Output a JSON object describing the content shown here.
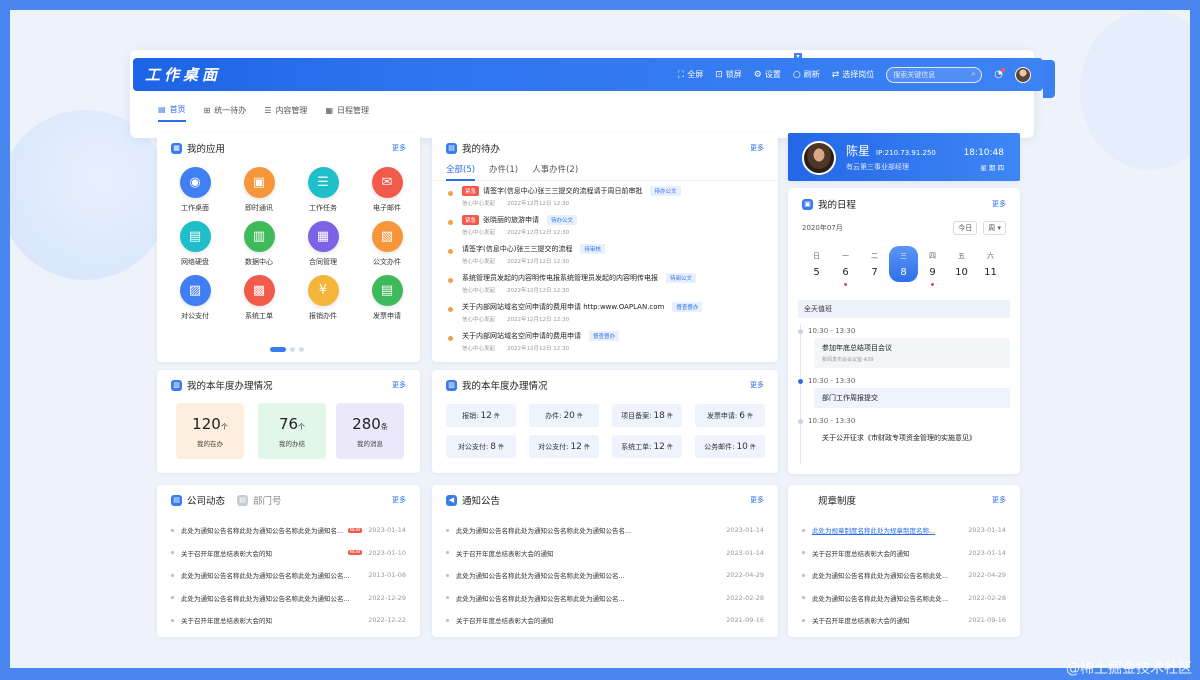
{
  "header": {
    "title": "工作桌面",
    "tools": [
      {
        "icon": "fullscreen-icon",
        "label": "全屏"
      },
      {
        "icon": "lock-icon",
        "label": "锁屏"
      },
      {
        "icon": "gear-icon",
        "label": "设置"
      },
      {
        "icon": "refresh-icon",
        "label": "刷新"
      },
      {
        "icon": "switch-role-icon",
        "label": "选择岗位"
      }
    ],
    "search_placeholder": "搜索关键信息"
  },
  "nav": [
    {
      "label": "首页",
      "active": true
    },
    {
      "label": "统一待办"
    },
    {
      "label": "内容管理"
    },
    {
      "label": "日程管理"
    }
  ],
  "apps": {
    "title": "我的应用",
    "more": "更多",
    "items": [
      {
        "label": "工作桌面",
        "color": "#3f7ef3",
        "glyph": "◉"
      },
      {
        "label": "即时通讯",
        "color": "#f6963a",
        "glyph": "▣"
      },
      {
        "label": "工作任务",
        "color": "#1fbfc9",
        "glyph": "☰"
      },
      {
        "label": "电子邮件",
        "color": "#f25b4b",
        "glyph": "✉"
      },
      {
        "label": "网络硬盘",
        "color": "#1fbfc9",
        "glyph": "▤"
      },
      {
        "label": "数据中心",
        "color": "#3fba5a",
        "glyph": "▥"
      },
      {
        "label": "合同管理",
        "color": "#7b62e6",
        "glyph": "▦"
      },
      {
        "label": "公文办件",
        "color": "#f6963a",
        "glyph": "▧"
      },
      {
        "label": "对公支付",
        "color": "#3f7ef3",
        "glyph": "▨"
      },
      {
        "label": "系统工单",
        "color": "#f25b4b",
        "glyph": "▩"
      },
      {
        "label": "报销办件",
        "color": "#f4b63a",
        "glyph": "¥"
      },
      {
        "label": "发票申请",
        "color": "#3fba5a",
        "glyph": "▤"
      }
    ]
  },
  "todo": {
    "title": "我的待办",
    "more": "更多",
    "tabs": [
      "全部(5)",
      "办件(1)",
      "人事办件(2)"
    ],
    "items": [
      {
        "urgent": "紧急",
        "text": "请签字(信息中心)张三三提交的流程请于周日前审批",
        "badge": "待办公文",
        "source": "信心中心发起",
        "time": "2022年12月12日 12:30"
      },
      {
        "urgent": "紧急",
        "text": "张晓丽的旅游申请",
        "badge": "待办公文",
        "source": "信心中心发起",
        "time": "2022年12月12日 12:30"
      },
      {
        "urgent": "",
        "text": "请签字(信息中心)张三三提交的流程",
        "badge": "待审核",
        "source": "信心中心发起",
        "time": "2022年12月12日 12:30"
      },
      {
        "urgent": "",
        "text": "系统管理员发起的内容明传电报系统管理员发起的内容明传电报",
        "badge": "待阅公文",
        "source": "信心中心发起",
        "time": "2022年12月12日 12:30"
      },
      {
        "urgent": "",
        "text": "关于内部网站域名空间申请的费用申请 http:www.OAPLAN.com",
        "badge": "督查督办",
        "source": "信心中心发起",
        "time": "2022年12月12日 12:30"
      },
      {
        "urgent": "",
        "text": "关于内部网站域名空间申请的费用申请",
        "badge": "督查督办",
        "source": "信心中心发起",
        "time": "2022年12月12日 12:30"
      }
    ]
  },
  "profile": {
    "name": "陈星",
    "ip": "IP:210.73.91.250",
    "dept": "有云第三事业部经理",
    "time": "18:10:48",
    "weekday": "星 期 四"
  },
  "schedule": {
    "title": "我的日程",
    "more": "更多",
    "month": "2020年07月",
    "today_btn": "今日",
    "view_select": "周",
    "days": [
      {
        "w": "日",
        "n": "5",
        "mark": false,
        "today": false
      },
      {
        "w": "一",
        "n": "6",
        "mark": true,
        "today": false
      },
      {
        "w": "二",
        "n": "7",
        "mark": false,
        "today": false
      },
      {
        "w": "三",
        "n": "8",
        "mark": false,
        "today": true
      },
      {
        "w": "四",
        "n": "9",
        "mark": true,
        "today": false
      },
      {
        "w": "五",
        "n": "10",
        "mark": false,
        "today": false
      },
      {
        "w": "六",
        "n": "11",
        "mark": false,
        "today": false
      }
    ],
    "allday": "全天值班",
    "items": [
      {
        "time": "10:30 - 13:30",
        "title": "参加年底总结项目会议",
        "sub": "新闻发布会会议室-A39",
        "active": false
      },
      {
        "time": "10:30 - 13:30",
        "title": "部门工作周报提交",
        "sub": "",
        "active": true
      },
      {
        "time": "10:30 - 13:30",
        "title": "关于公开征求《市财政专项资金管理的实施意见》",
        "sub": "",
        "active": false
      }
    ]
  },
  "stats1": {
    "title": "我的本年度办理情况",
    "more": "更多",
    "items": [
      {
        "value": "120",
        "unit": "个",
        "label": "我的在办",
        "bg": "#fdeedd"
      },
      {
        "value": "76",
        "unit": "个",
        "label": "我的办结",
        "bg": "#e2f6ea"
      },
      {
        "value": "280",
        "unit": "条",
        "label": "我的消息",
        "bg": "#ebe8fb"
      }
    ]
  },
  "stats2": {
    "title": "我的本年度办理情况",
    "more": "更多",
    "items": [
      {
        "label": "报销:",
        "value": "12",
        "unit": "件"
      },
      {
        "label": "办件:",
        "value": "20",
        "unit": "件"
      },
      {
        "label": "项目备案:",
        "value": "18",
        "unit": "件"
      },
      {
        "label": "发票申请:",
        "value": "6",
        "unit": "件"
      },
      {
        "label": "对公支付:",
        "value": "8",
        "unit": "件"
      },
      {
        "label": "对公支付:",
        "value": "12",
        "unit": "件"
      },
      {
        "label": "系统工单:",
        "value": "12",
        "unit": "件"
      },
      {
        "label": "公务邮件:",
        "value": "10",
        "unit": "件"
      }
    ]
  },
  "news": {
    "tab_active": "公司动态",
    "tab_other": "部门号",
    "more": "更多",
    "items": [
      {
        "text": "此处为通知公告名称此处为通知公告名称此处为通知名...",
        "date": "2023-01-14",
        "new": "NEW"
      },
      {
        "text": "关于召开年度总结表彰大会的知",
        "date": "2023-01-10",
        "new": "NEW"
      },
      {
        "text": "此处为通知公告名称此处为通知公告名称此处为通知公名...",
        "date": "2013-01-08",
        "new": ""
      },
      {
        "text": "此处为通知公告名称此处为通知公告名称此处为通知公名...",
        "date": "2022-12-29",
        "new": ""
      },
      {
        "text": "关于召开年度总结表彰大会的知",
        "date": "2022-12-22",
        "new": ""
      }
    ]
  },
  "notice": {
    "title": "通知公告",
    "more": "更多",
    "items": [
      {
        "text": "此处为通知公告名称此处为通知公告名称此处为通知公告名...",
        "date": "2023-01-14"
      },
      {
        "text": "关于召开年度总结表彰大会的通知",
        "date": "2023-01-14"
      },
      {
        "text": "此处为通知公告名称此处为通知公告名称此处为通知公名...",
        "date": "2022-04-29"
      },
      {
        "text": "此处为通知公告名称此处为通知公告名称此处为通知公名...",
        "date": "2022-02-28"
      },
      {
        "text": "关于召开年度总结表彰大会的通知",
        "date": "2021-09-16"
      }
    ]
  },
  "rules": {
    "title": "规章制度",
    "more": "更多",
    "items": [
      {
        "text": "此处为规章制度名称此处为规章制度名称...",
        "date": "2023-01-14",
        "link": true
      },
      {
        "text": "关于召开年度总结表彰大会的通知",
        "date": "2023-01-14",
        "link": false
      },
      {
        "text": "此处为通知公告名称此处为通知公告名称此处...",
        "date": "2022-04-29",
        "link": false
      },
      {
        "text": "此处为通知公告名称此处为通知公告名称此处...",
        "date": "2022-02-28",
        "link": false
      },
      {
        "text": "关于召开年度总结表彰大会的通知",
        "date": "2021-09-16",
        "link": false
      }
    ]
  },
  "watermark": "@稀土掘金技术社区"
}
